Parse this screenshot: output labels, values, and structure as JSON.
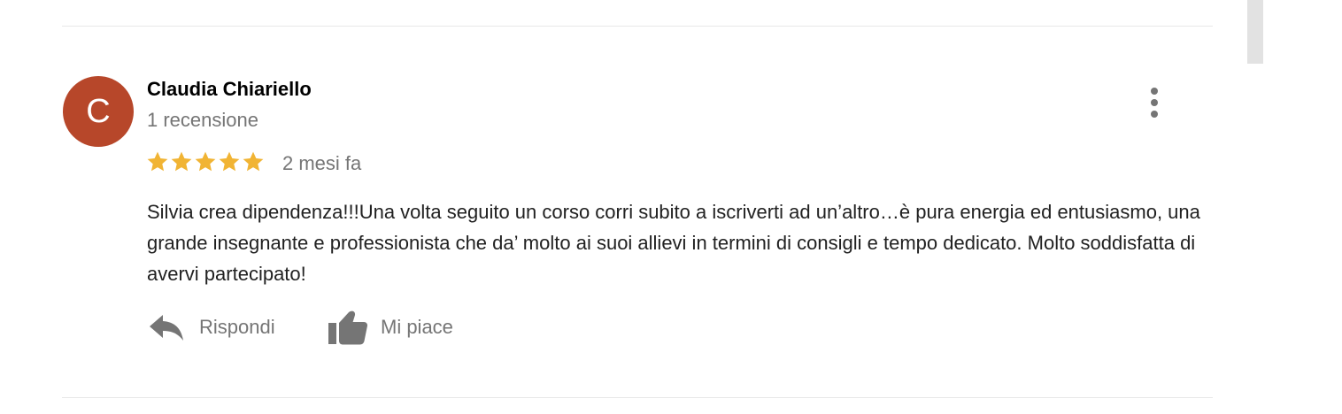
{
  "review": {
    "author": {
      "initial": "C",
      "name": "Claudia Chiariello",
      "review_count": "1 recensione",
      "avatar_color": "#b7472a"
    },
    "rating": 5,
    "rating_max": 5,
    "time_ago": "2 mesi fa",
    "text": "Silvia crea dipendenza!!!Una volta seguito un corso corri subito a iscriverti ad un’altro…è pura energia ed entusiasmo, una grande insegnante e professionista che da’ molto ai suoi allievi in termini di consigli e tempo dedicato. Molto soddisfatta di avervi partecipato!",
    "actions": {
      "reply_label": "Rispondi",
      "like_label": "Mi piace"
    },
    "more_icon": "more-vertical-icon"
  },
  "colors": {
    "star": "#f1b434",
    "icon_gray": "#757575",
    "divider": "#e8e8e8"
  }
}
